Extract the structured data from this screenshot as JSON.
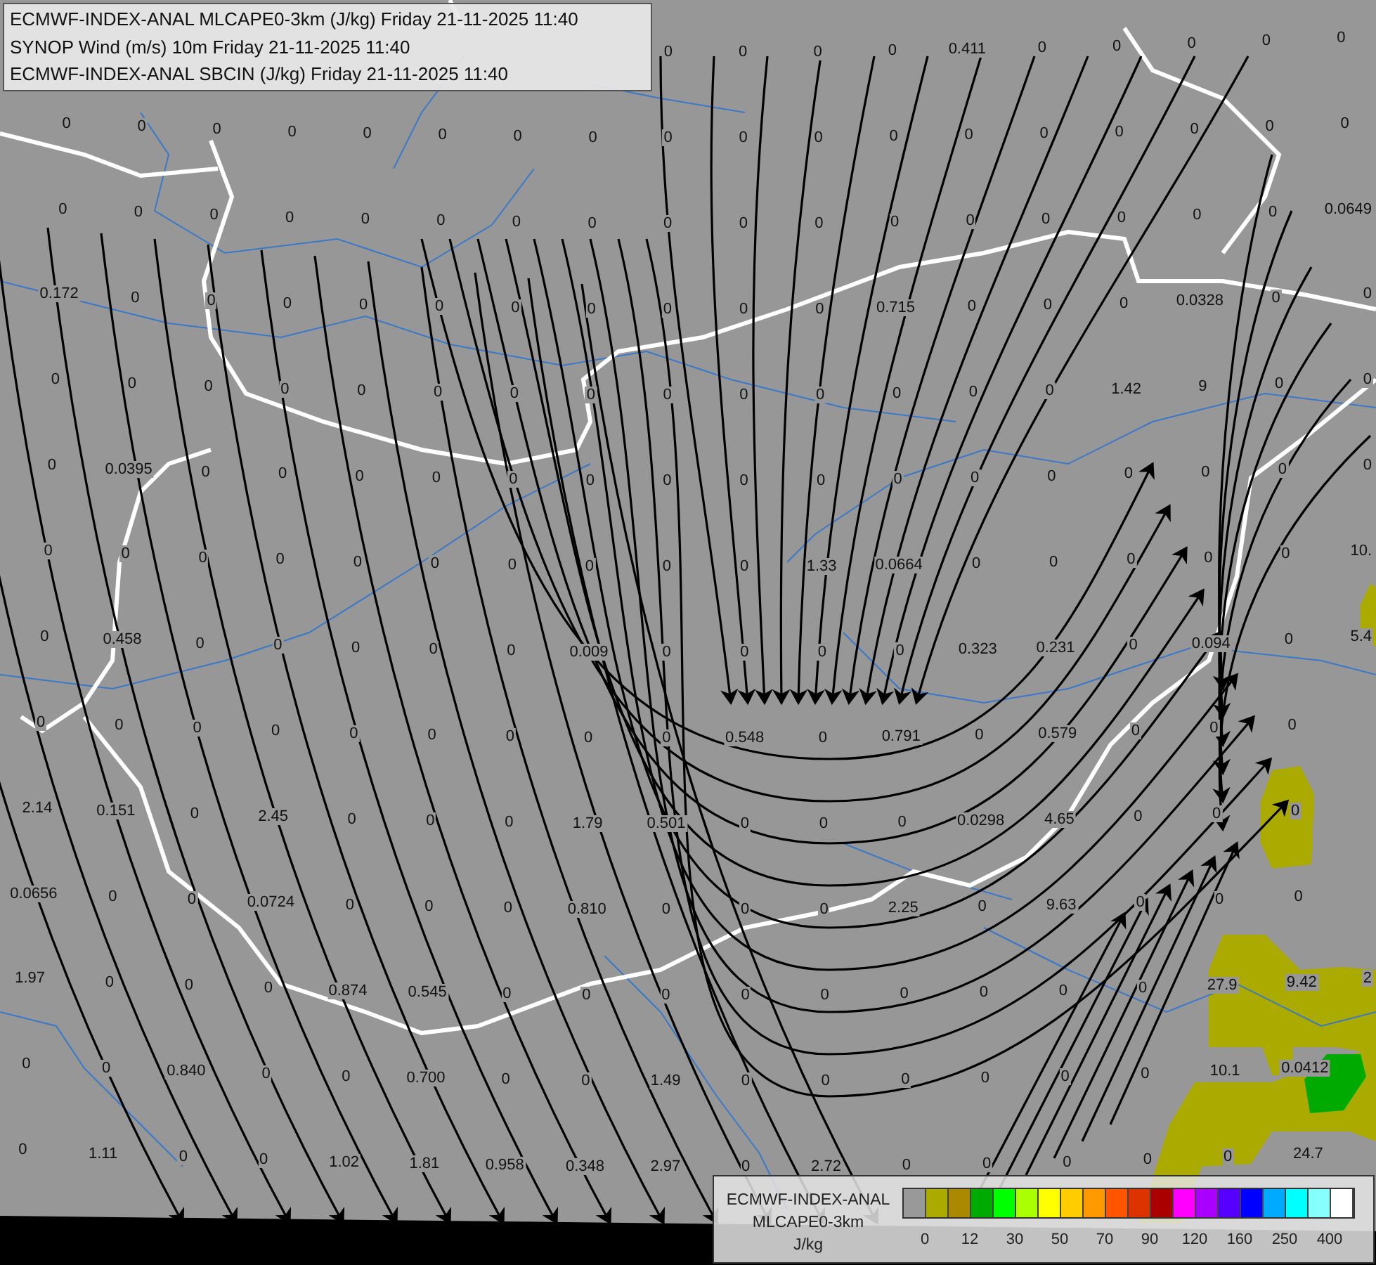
{
  "title_box": {
    "lines": [
      "ECMWF-INDEX-ANAL MLCAPE0-3km (J/kg) Friday 21-11-2025 11:40",
      "SYNOP Wind (m/s) 10m Friday 21-11-2025 11:40",
      "ECMWF-INDEX-ANAL SBCIN (J/kg) Friday 21-11-2025 11:40"
    ]
  },
  "grid_values": {
    "rows": [
      [
        null,
        null,
        null,
        null,
        null,
        null,
        null,
        null,
        "0",
        "0",
        "0",
        "0",
        "0.411",
        "0",
        "0",
        "0",
        "0",
        "0"
      ],
      [
        "0",
        "0",
        "0",
        "0",
        "0",
        "0",
        "0",
        "0",
        "0",
        "0",
        "0",
        "0",
        "0",
        "0",
        "0",
        "0",
        "0",
        "0"
      ],
      [
        "0",
        "0",
        "0",
        "0",
        "0",
        "0",
        "0",
        "0",
        "0",
        "0",
        "0",
        "0",
        "0",
        "0",
        "0",
        "0",
        "0",
        "0.0649"
      ],
      [
        "0.172",
        "0",
        "0",
        "0",
        "0",
        "0",
        "0",
        "0",
        "0",
        "0",
        "0",
        "0.715",
        "0",
        "0",
        "0",
        "0.0328",
        "0",
        "0"
      ],
      [
        "0",
        "0",
        "0",
        "0",
        "0",
        "0",
        "0",
        "0",
        "0",
        "0",
        "0",
        "0",
        "0",
        "0",
        "1.42",
        "9",
        "0",
        "0"
      ],
      [
        "0",
        "0.0395",
        "0",
        "0",
        "0",
        "0",
        "0",
        "0",
        "0",
        "0",
        "0",
        "0",
        "0",
        "0",
        "0",
        "0",
        "0",
        "0"
      ],
      [
        "0",
        "0",
        "0",
        "0",
        "0",
        "0",
        "0",
        "0",
        "0",
        "0",
        "1.33",
        "0.0664",
        "0",
        "0",
        "0",
        "0",
        "0",
        "10."
      ],
      [
        "0",
        "0.458",
        "0",
        "0",
        "0",
        "0",
        "0",
        "0.009",
        "0",
        "0",
        "0",
        "0",
        "0.323",
        "0.231",
        "0",
        "0.094",
        "0",
        "5.4"
      ],
      [
        "0",
        "0",
        "0",
        "0",
        "0",
        "0",
        "0",
        "0",
        "0",
        "0.548",
        "0",
        "0.791",
        "0",
        "0.579",
        "0",
        "0",
        "0",
        null
      ],
      [
        "2.14",
        "0.151",
        "0",
        "2.45",
        "0",
        "0",
        "0",
        "1.79",
        "0.501",
        "0",
        "0",
        "0",
        "0.0298",
        "4.65",
        "0",
        "0",
        "0",
        null
      ],
      [
        "0.0656",
        "0",
        "0",
        "0.0724",
        "0",
        "0",
        "0",
        "0.810",
        "0",
        "0",
        "0",
        "2.25",
        "0",
        "9.63",
        "0",
        "0",
        "0",
        null
      ],
      [
        "1.97",
        "0",
        "0",
        "0",
        "0.874",
        "0.545",
        "0",
        "0",
        "0",
        "0",
        "0",
        "0",
        "0",
        "0",
        "0",
        "27.9",
        "9.42",
        "2"
      ],
      [
        "0",
        "0",
        "0.840",
        "0",
        "0",
        "0.700",
        "0",
        "0",
        "1.49",
        "0",
        "0",
        "0",
        "0",
        "0",
        "0",
        "10.1",
        "0.0412",
        null
      ],
      [
        "0",
        "1.11",
        "0",
        "0",
        "1.02",
        "1.81",
        "0.958",
        "0.348",
        "2.97",
        "0",
        "2.72",
        "0",
        "0",
        "0",
        "0",
        "0",
        "24.7",
        null
      ]
    ]
  },
  "legend": {
    "title_lines": [
      "ECMWF-INDEX-ANAL",
      "MLCAPE0-3km"
    ],
    "unit": "J/kg",
    "swatches": [
      {
        "color": "#999999"
      },
      {
        "color": "#aaaa00"
      },
      {
        "color": "#aa8800"
      },
      {
        "color": "#00aa00"
      },
      {
        "color": "#00ff00"
      },
      {
        "color": "#aaff00"
      },
      {
        "color": "#ffff00"
      },
      {
        "color": "#ffcc00"
      },
      {
        "color": "#ff9900"
      },
      {
        "color": "#ff5500"
      },
      {
        "color": "#dd3300"
      },
      {
        "color": "#aa0000"
      },
      {
        "color": "#ff00ff"
      },
      {
        "color": "#aa00ff"
      },
      {
        "color": "#5500ff"
      },
      {
        "color": "#0000ff"
      },
      {
        "color": "#00aaff"
      },
      {
        "color": "#00ffff"
      },
      {
        "color": "#88ffff"
      },
      {
        "color": "#ffffff"
      }
    ],
    "ticks": [
      "0",
      "12",
      "30",
      "50",
      "70",
      "90",
      "120",
      "160",
      "250",
      "400"
    ]
  }
}
